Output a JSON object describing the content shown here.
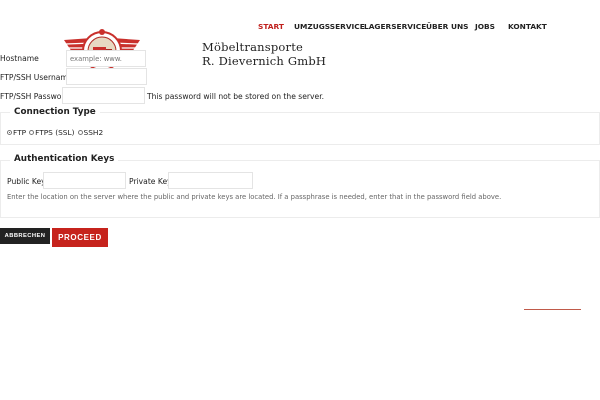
{
  "logo": {
    "line1": "Möbeltransporte",
    "line2": "R. Dievernich GmbH"
  },
  "nav": {
    "items": [
      {
        "label": "START",
        "active": true
      },
      {
        "label": "UMZUGSSERVICE",
        "active": false
      },
      {
        "label": "LAGERSERVICE",
        "active": false
      },
      {
        "label": "ÜBER UNS",
        "active": false
      },
      {
        "label": "JOBS",
        "active": false
      },
      {
        "label": "KONTAKT",
        "active": false
      }
    ]
  },
  "form": {
    "hostname_label": "Hostname",
    "hostname_placeholder": "example: www.",
    "username_label": "FTP/SSH Username",
    "password_label": "FTP/SSH Password",
    "password_note": "This password will not be stored on the server.",
    "connection": {
      "legend": "Connection Type",
      "options": [
        {
          "label": "FTP",
          "checked": true
        },
        {
          "label": "FTPS (SSL)",
          "checked": false
        },
        {
          "label": "SSH2",
          "checked": false
        }
      ]
    },
    "keys": {
      "legend": "Authentication Keys",
      "public_label": "Public Key:",
      "private_label": "Private Key:",
      "help": "Enter the location on the server where the public and private keys are located. If a passphrase is needed, enter that in the password field above."
    },
    "cancel_label": "ABBRECHEN",
    "proceed_label": "PROCEED"
  },
  "colors": {
    "accent": "#c0201d",
    "button_dark": "#222222",
    "button_red": "#c6231c"
  }
}
